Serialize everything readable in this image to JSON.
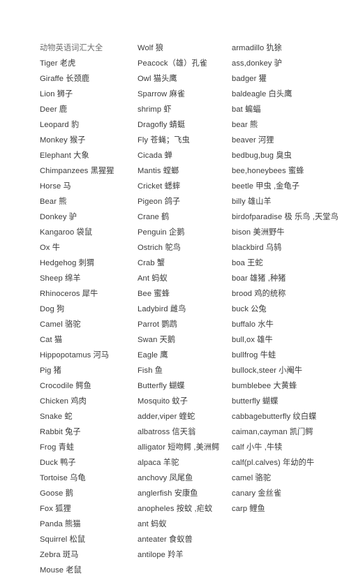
{
  "document": {
    "title": "动物英语词汇大全",
    "columns": [
      {
        "name": "column-1",
        "entries": [
          "动物英语词汇大全",
          "Tiger 老虎",
          "Giraffe 长颈鹿",
          "Lion 狮子",
          "Deer 鹿",
          "Leopard 豹",
          "Monkey 猴子",
          "Elephant 大象",
          "Chimpanzees 黑猩猩",
          "Horse 马",
          "Bear 熊",
          "Donkey 驴",
          "Kangaroo 袋鼠",
          "Ox 牛",
          "Hedgehog 刺猬",
          "Sheep 绵羊",
          "Rhinoceros 犀牛",
          "Dog 狗",
          "Camel 骆驼",
          "Cat 猫",
          "Hippopotamus 河马",
          "Pig 猪",
          "Crocodile 鳄鱼",
          "Chicken 鸡肉",
          "Snake 蛇",
          "Rabbit 兔子",
          "Frog 青蛙",
          "Duck 鸭子",
          "Tortoise 乌龟",
          "Goose 鹅",
          "Fox 狐狸",
          "Panda 熊猫",
          "Squirrel 松鼠",
          "Zebra 斑马",
          "Mouse 老鼠"
        ]
      },
      {
        "name": "column-2",
        "entries": [
          "Wolf 狼",
          "Peacock（雄）孔雀",
          "Owl 猫头鹰",
          "Sparrow 麻雀",
          "shrimp 虾",
          "Dragofly 蜻蜓",
          "Fly 苍蝇；飞虫",
          "Cicada 蝉",
          "Mantis 螳螂",
          "Cricket 蟋蟀",
          "Pigeon 鸽子",
          "Crane 鹤",
          "Penguin 企鹅",
          "Ostrich 鸵鸟",
          "Crab 蟹",
          "Ant 蚂蚁",
          "Bee 蜜蜂",
          "Ladybird 雌鸟",
          "Parrot 鹦鹉",
          "Swan 天鹅",
          "Eagle 鹰",
          "Fish 鱼",
          "Butterfly 蝴蝶",
          "Mosquito 蚊子",
          "adder,viper 蝰蛇",
          "albatross 信天翁",
          "alligator 短吻鳄 ,美洲鳄",
          "alpaca 羊驼",
          "anchovy 凤尾鱼",
          "anglerfish 安康鱼",
          "anopheles 按蚊 ,疟蚊",
          "ant 蚂蚁",
          "anteater 食蚁兽",
          "antilope 羚羊"
        ]
      },
      {
        "name": "column-3",
        "entries": [
          "armadillo 犰狳",
          "ass,donkey 驴",
          "badger 獾",
          "baldeagle 白头鹰",
          "bat 蝙蝠",
          "bear 熊",
          "beaver 河狸",
          "bedbug,bug 臭虫",
          "bee,honeybees 蜜蜂",
          "beetle 甲虫 ,金龟子",
          "billy 雄山羊",
          "birdofparadise 极 乐鸟 ,天堂鸟",
          "bison 美洲野牛",
          "blackbird 乌鸫",
          "boa 王蛇",
          "boar 雄猪 ,种猪",
          "brood 鸡的统称",
          "buck 公兔",
          "buffalo 水牛",
          "bull,ox 雄牛",
          "bullfrog 牛蛙",
          "bullock,steer 小阉牛",
          "bumblebee 大黄蜂",
          "butterfly 蝴蝶",
          "cabbagebutterfly 纹白蝶",
          "caiman,cayman 凯门鳄",
          "calf 小牛 ,牛犊",
          "calf(pl.calves) 年幼的牛",
          "camel 骆驼",
          "canary 金丝雀",
          "carp 鲤鱼"
        ]
      }
    ]
  }
}
